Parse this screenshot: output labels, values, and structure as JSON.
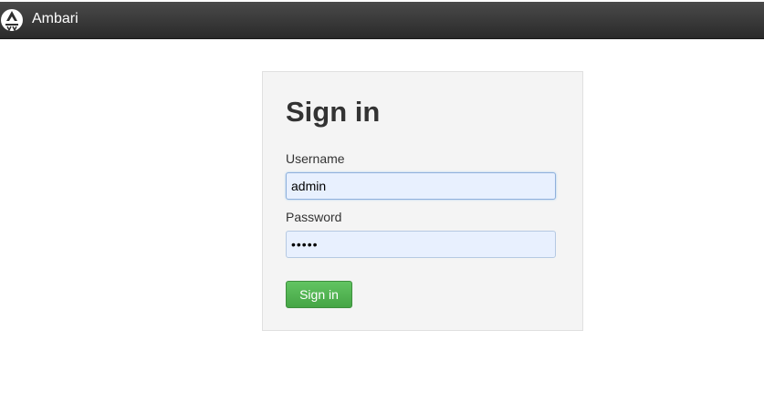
{
  "navbar": {
    "brand": "Ambari",
    "logo_icon": "ambari-elephant-logo-icon"
  },
  "login": {
    "title": "Sign in",
    "username_label": "Username",
    "username_value": "admin",
    "password_label": "Password",
    "password_value": "admin",
    "submit_label": "Sign in"
  },
  "colors": {
    "navbar": "#333333",
    "panel": "#f4f4f4",
    "button": "#51b351",
    "autofill": "#e8f0fe"
  }
}
